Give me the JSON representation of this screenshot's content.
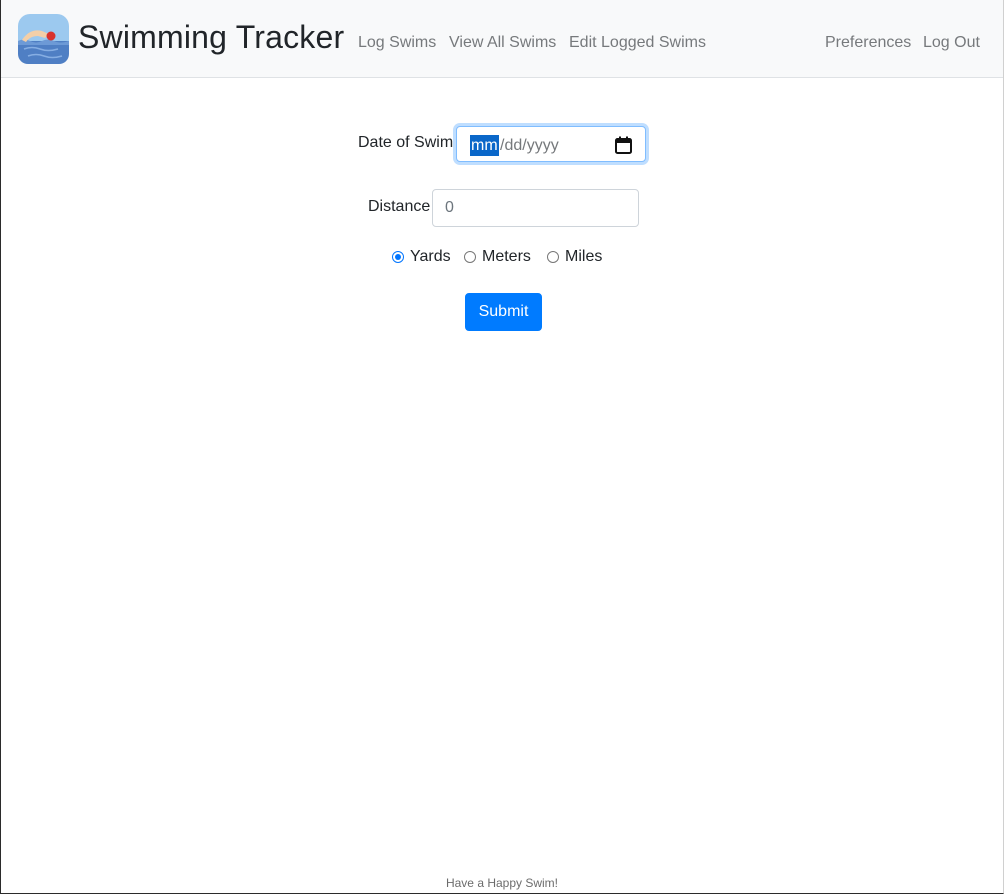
{
  "navbar": {
    "brand": "Swimming Tracker",
    "logo_icon": "swimmer-icon",
    "links": {
      "log_swims": "Log Swims",
      "view_all_swims": "View All Swims",
      "edit_logged_swims": "Edit Logged Swims",
      "preferences": "Preferences",
      "log_out": "Log Out"
    }
  },
  "form": {
    "date_label": "Date of Swim",
    "date_placeholder_mm": "mm",
    "date_placeholder_rest": "/dd/yyyy",
    "calendar_icon": "calendar-icon",
    "distance_label": "Distance",
    "distance_placeholder": "0",
    "units": {
      "yards": "Yards",
      "meters": "Meters",
      "miles": "Miles",
      "selected": "Yards"
    },
    "submit_label": "Submit"
  },
  "footer": {
    "text": "Have a Happy Swim!"
  },
  "colors": {
    "primary": "#007bff",
    "navbar_bg": "#f8f9fa",
    "nav_link": "#76797c",
    "date_selection": "#0a67c9"
  }
}
